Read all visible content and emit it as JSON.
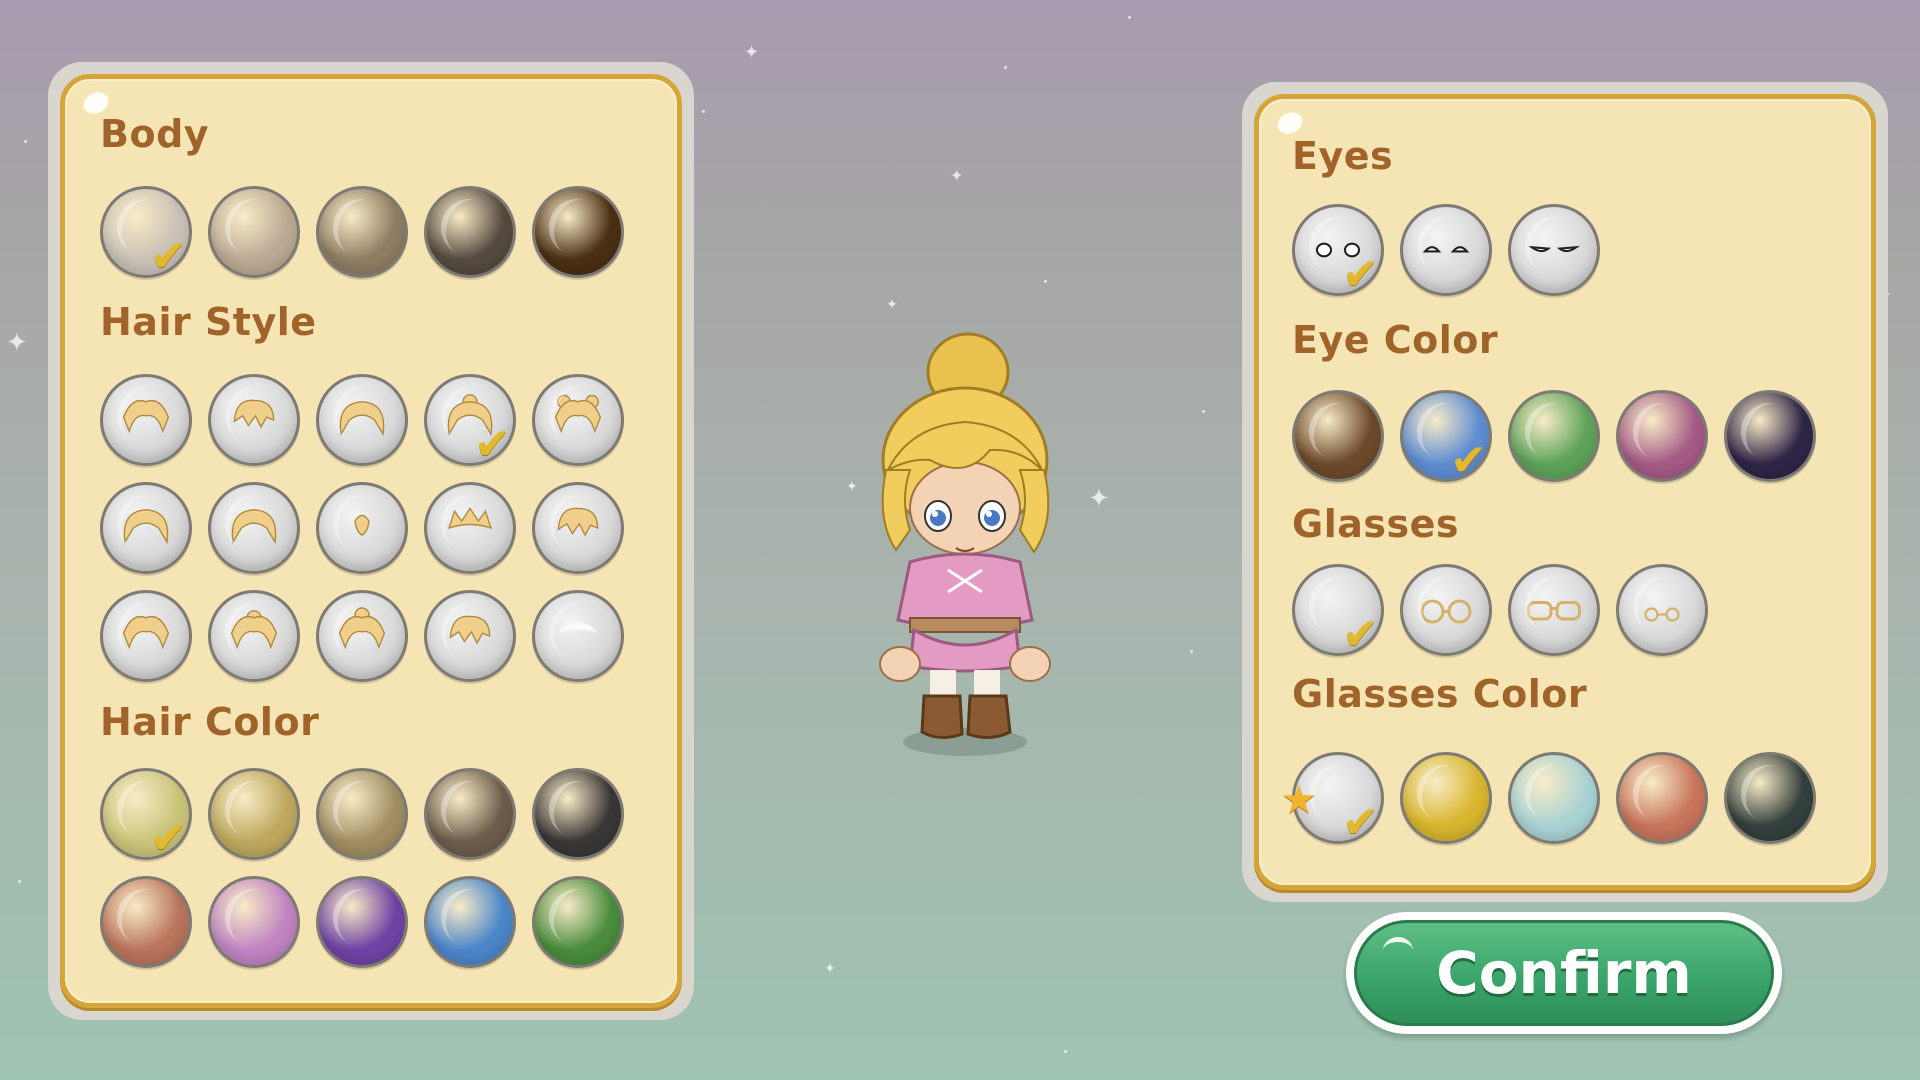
{
  "left_panel": {
    "sections": {
      "body": {
        "title": "Body"
      },
      "hair_style": {
        "title": "Hair Style"
      },
      "hair_color": {
        "title": "Hair Color"
      }
    },
    "body_swatches": [
      "#c9c1b6",
      "#bba994",
      "#8f7d63",
      "#544a3f",
      "#4a2f14"
    ],
    "body_selected": 0,
    "hair_style_selected": 3,
    "hair_color_swatches": [
      "#c9c47a",
      "#bda85e",
      "#a08d63",
      "#6d5c4b",
      "#393636",
      "#b9745c",
      "#c084c2",
      "#6f43a4",
      "#4c86c9",
      "#4a8c3e"
    ],
    "hair_color_selected": 0
  },
  "right_panel": {
    "sections": {
      "eyes": {
        "title": "Eyes"
      },
      "eye_color": {
        "title": "Eye Color"
      },
      "glasses": {
        "title": "Glasses"
      },
      "glasses_color": {
        "title": "Glasses Color"
      }
    },
    "eyes_selected": 0,
    "eye_color_swatches": [
      "#6d4a2c",
      "#5f8dd2",
      "#5ea35a",
      "#a55a86",
      "#2f2547"
    ],
    "eye_color_selected": 1,
    "glasses_selected": 0,
    "glasses_color_swatches": [
      "silver",
      "#d8b52e",
      "#a9d2d3",
      "#c8755c",
      "#34403d"
    ],
    "glasses_color_selected": 0
  },
  "confirm_button": {
    "label": "Confirm"
  },
  "colors": {
    "panel_bg": "#f6e5b4",
    "panel_border": "#d6a53a",
    "title_color": "#a0642a",
    "check_color": "#e2b92c",
    "confirm_green": "#3aa56a"
  },
  "icons": {
    "check": "checkmark-icon",
    "star": "star-icon"
  }
}
